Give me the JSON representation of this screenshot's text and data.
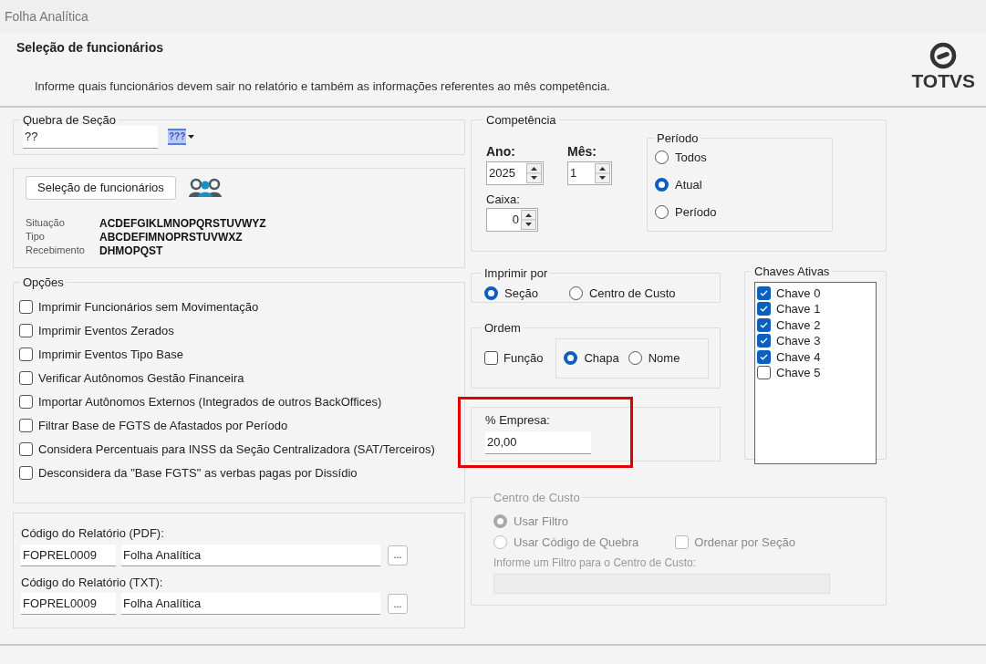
{
  "window": {
    "title": "Folha Analítica"
  },
  "header": {
    "title": "Seleção de funcionários",
    "description": "Informe quais funcionários devem sair no relatório e também as informações referentes ao mês competência.",
    "logo_text": "TOTVS"
  },
  "quebra_secao": {
    "legend": "Quebra de Seção",
    "value": "??",
    "picker_label": "???"
  },
  "selecao": {
    "button": "Seleção de funcionários",
    "filters": [
      {
        "label": "Situação",
        "value": "ACDEFGIKLMNOPQRSTUVWYZ"
      },
      {
        "label": "Tipo",
        "value": "ABCDEFIMNOPRSTUVWXZ"
      },
      {
        "label": "Recebimento",
        "value": "DHMOPQST"
      }
    ]
  },
  "opcoes": {
    "legend": "Opções",
    "items": [
      {
        "label": "Imprimir Funcionários sem Movimentação",
        "checked": false
      },
      {
        "label": "Imprimir Eventos Zerados",
        "checked": false
      },
      {
        "label": "Imprimir Eventos Tipo Base",
        "checked": false
      },
      {
        "label": "Verificar Autônomos Gestão Financeira",
        "checked": false
      },
      {
        "label": "Importar Autônomos Externos (Integrados de outros BackOffices)",
        "checked": false
      },
      {
        "label": "Filtrar Base de FGTS de Afastados por Período",
        "checked": false
      },
      {
        "label": "Considera Percentuais para INSS da Seção Centralizadora (SAT/Terceiros)",
        "checked": false
      },
      {
        "label": "Desconsidera da \"Base FGTS\" as verbas pagas por Dissídio",
        "checked": false
      }
    ]
  },
  "relatorios": [
    {
      "label": "Código do Relatório (PDF):",
      "code": "FOPREL0009",
      "name": "Folha Analítica",
      "browse": "..."
    },
    {
      "label": "Código do Relatório (TXT):",
      "code": "FOPREL0009",
      "name": "Folha Analítica",
      "browse": "..."
    }
  ],
  "competencia": {
    "legend": "Competência",
    "ano": {
      "label": "Ano:",
      "value": "2025"
    },
    "mes": {
      "label": "Mês:",
      "value": "1"
    },
    "caixa": {
      "label": "Caixa:",
      "value": "0"
    },
    "periodo": {
      "legend": "Período",
      "options": [
        {
          "label": "Todos",
          "selected": false
        },
        {
          "label": "Atual",
          "selected": true
        },
        {
          "label": "Período",
          "selected": false
        }
      ]
    }
  },
  "imprimir_por": {
    "legend": "Imprimir por",
    "options": [
      {
        "label": "Seção",
        "selected": true
      },
      {
        "label": "Centro de Custo",
        "selected": false
      }
    ]
  },
  "ordem": {
    "legend": "Ordem",
    "funcao": {
      "label": "Função",
      "checked": false
    },
    "options": [
      {
        "label": "Chapa",
        "selected": true
      },
      {
        "label": "Nome",
        "selected": false
      }
    ]
  },
  "empresa": {
    "label": "% Empresa:",
    "value": "20,00",
    "highlighted": true
  },
  "chaves": {
    "legend": "Chaves Ativas",
    "items": [
      {
        "label": "Chave 0",
        "checked": true
      },
      {
        "label": "Chave 1",
        "checked": true
      },
      {
        "label": "Chave 2",
        "checked": true
      },
      {
        "label": "Chave 3",
        "checked": true
      },
      {
        "label": "Chave 4",
        "checked": true
      },
      {
        "label": "Chave 5",
        "checked": false
      }
    ]
  },
  "centro_custo": {
    "legend": "Centro de Custo",
    "disabled": true,
    "options": [
      {
        "label": "Usar Filtro",
        "selected": true
      },
      {
        "label": "Usar Código de Quebra",
        "selected": false
      }
    ],
    "ordenar": {
      "label": "Ordenar por Seção",
      "checked": false
    },
    "filter_label": "Informe um Filtro para o Centro de Custo:"
  }
}
